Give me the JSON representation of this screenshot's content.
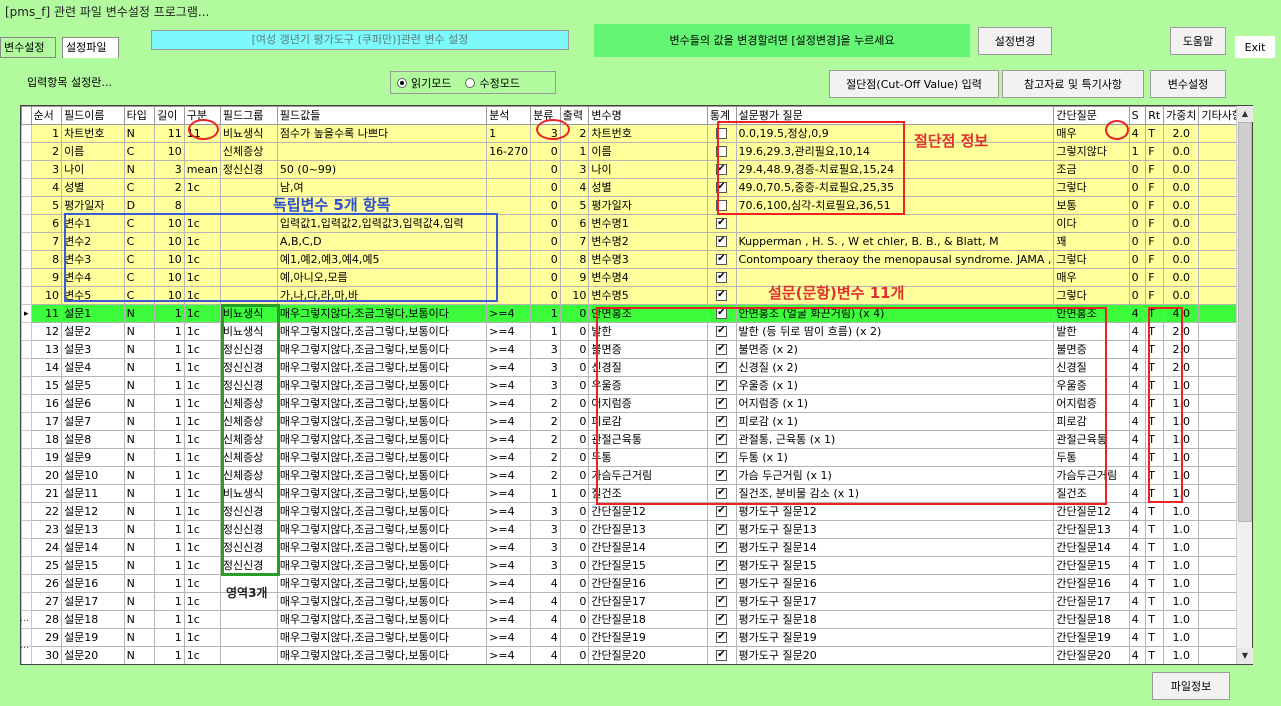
{
  "window": {
    "title": "[pms_f] 관련 파일 변수설정 프로그램..."
  },
  "tabs": [
    {
      "label": "변수설정"
    },
    {
      "label": "설정파일"
    }
  ],
  "header": {
    "form_title": "[여성 갱년기 평가도구 (쿠퍼만)]관련 변수 설정",
    "message": "변수들의 값을 변경할려면 [설정변경]을 누르세요",
    "change_button": "설정변경",
    "help_button": "도움말",
    "exit_button": "Exit"
  },
  "toolbar": {
    "input_label": "입력항목 설정란...",
    "read_mode": "읽기모드",
    "edit_mode": "수정모드",
    "mode_selected": "read",
    "cutoff_button": "절단점(Cut-Off Value) 입력",
    "reference_button": "참고자료 및 특기사항",
    "variable_button": "변수설정"
  },
  "table": {
    "columns": [
      "순서",
      "필드이름",
      "타입",
      "길이",
      "구분",
      "필드그룹",
      "필드값들",
      "분석",
      "분류",
      "출력",
      "변수명",
      "통계",
      "설문평가 질문",
      "간단질문",
      "S",
      "Rt",
      "가중치",
      "기타사항"
    ],
    "rows": [
      [
        "1",
        "차트번호",
        "N",
        "11",
        "11",
        "비뇨생식",
        "점수가 높을수록 나쁘다",
        "1",
        "3",
        "2",
        "차트번호",
        "off",
        "0.0,19.5,정상,0,9",
        "매우",
        "4",
        "T",
        "2.0",
        "",
        "yel"
      ],
      [
        "2",
        "이름",
        "C",
        "10",
        "",
        "신체증상",
        "",
        "16-270",
        "0",
        "1",
        "이름",
        "off",
        "19.6,29.3,관리필요,10,14",
        "그렇지않다",
        "1",
        "F",
        "0.0",
        "",
        "yel"
      ],
      [
        "3",
        "나이",
        "N",
        "3",
        "mean",
        "정신신경",
        "50 (0~99)",
        "",
        "0",
        "3",
        "나이",
        "on",
        "29.4,48.9,경증-치료필요,15,24",
        "조금",
        "0",
        "F",
        "0.0",
        "",
        "yel"
      ],
      [
        "4",
        "성별",
        "C",
        "2",
        "1c",
        "",
        "남,여",
        "",
        "0",
        "4",
        "성별",
        "on",
        "49.0,70.5,중증-치료필요,25,35",
        "그렇다",
        "0",
        "F",
        "0.0",
        "",
        "yel"
      ],
      [
        "5",
        "평가일자",
        "D",
        "8",
        "",
        "",
        "",
        "",
        "0",
        "5",
        "평가일자",
        "off",
        "70.6,100,심각-치료필요,36,51",
        "보통",
        "0",
        "F",
        "0.0",
        "",
        "yel"
      ],
      [
        "6",
        "변수1",
        "C",
        "10",
        "1c",
        "",
        "입력값1,입력값2,입력값3,입력값4,입력",
        "",
        "0",
        "6",
        "변수명1",
        "on",
        "",
        "이다",
        "0",
        "F",
        "0.0",
        "",
        "yel"
      ],
      [
        "7",
        "변수2",
        "C",
        "10",
        "1c",
        "",
        "A,B,C,D",
        "",
        "0",
        "7",
        "변수명2",
        "on",
        "Kupperman , H. S. , W et chler, B. B., & Blatt, M",
        "꽤",
        "0",
        "F",
        "0.0",
        "",
        "yel"
      ],
      [
        "8",
        "변수3",
        "C",
        "10",
        "1c",
        "",
        "예1,예2,예3,예4,예5",
        "",
        "0",
        "8",
        "변수명3",
        "on",
        "Contompoary theraoy the menopausal syndrome. JAMA ,",
        "그렇다",
        "0",
        "F",
        "0.0",
        "",
        "yel"
      ],
      [
        "9",
        "변수4",
        "C",
        "10",
        "1c",
        "",
        "예,아니오,모름",
        "",
        "0",
        "9",
        "변수명4",
        "on",
        "",
        "매우",
        "0",
        "F",
        "0.0",
        "",
        "yel"
      ],
      [
        "10",
        "변수5",
        "C",
        "10",
        "1c",
        "",
        "가,나,다,라,마,바",
        "",
        "0",
        "10",
        "변수명5",
        "on",
        "",
        "그렇다",
        "0",
        "F",
        "0.0",
        "",
        "yel"
      ],
      [
        "11",
        "설문1",
        "N",
        "1",
        "1c",
        "비뇨생식",
        "매우그렇지않다,조금그렇다,보통이다",
        "&gt;=4",
        "1",
        "0",
        "안면홍조",
        "on",
        "안면홍조 (얼굴 화끈거림) (x 4)",
        "안면홍조",
        "4",
        "T",
        "4.0",
        "",
        "grn"
      ],
      [
        "12",
        "설문2",
        "N",
        "1",
        "1c",
        "비뇨생식",
        "매우그렇지않다,조금그렇다,보통이다",
        "&gt;=4",
        "1",
        "0",
        "발한",
        "on",
        "발한 (등 뒤로 땀이 흐름) (x 2)",
        "발한",
        "4",
        "T",
        "2.0",
        "",
        "wht"
      ],
      [
        "13",
        "설문3",
        "N",
        "1",
        "1c",
        "정신신경",
        "매우그렇지않다,조금그렇다,보통이다",
        "&gt;=4",
        "3",
        "0",
        "불면증",
        "on",
        "불면증 (x 2)",
        "불면증",
        "4",
        "T",
        "2.0",
        "",
        "wht"
      ],
      [
        "14",
        "설문4",
        "N",
        "1",
        "1c",
        "정신신경",
        "매우그렇지않다,조금그렇다,보통이다",
        "&gt;=4",
        "3",
        "0",
        "신경질",
        "on",
        "신경질 (x 2)",
        "신경질",
        "4",
        "T",
        "2.0",
        "",
        "wht"
      ],
      [
        "15",
        "설문5",
        "N",
        "1",
        "1c",
        "정신신경",
        "매우그렇지않다,조금그렇다,보통이다",
        "&gt;=4",
        "3",
        "0",
        "우울증",
        "on",
        "우울증 (x 1)",
        "우울증",
        "4",
        "T",
        "1.0",
        "",
        "wht"
      ],
      [
        "16",
        "설문6",
        "N",
        "1",
        "1c",
        "신체증상",
        "매우그렇지않다,조금그렇다,보통이다",
        "&gt;=4",
        "2",
        "0",
        "어지럼증",
        "on",
        "어지럼증 (x 1)",
        "어지럼증",
        "4",
        "T",
        "1.0",
        "",
        "wht"
      ],
      [
        "17",
        "설문7",
        "N",
        "1",
        "1c",
        "신체증상",
        "매우그렇지않다,조금그렇다,보통이다",
        "&gt;=4",
        "2",
        "0",
        "피로감",
        "on",
        "피로감 (x 1)",
        "피로감",
        "4",
        "T",
        "1.0",
        "",
        "wht"
      ],
      [
        "18",
        "설문8",
        "N",
        "1",
        "1c",
        "신체증상",
        "매우그렇지않다,조금그렇다,보통이다",
        "&gt;=4",
        "2",
        "0",
        "관절근육통",
        "on",
        "관절통, 근육통 (x 1)",
        "관절근육통",
        "4",
        "T",
        "1.0",
        "",
        "wht"
      ],
      [
        "19",
        "설문9",
        "N",
        "1",
        "1c",
        "신체증상",
        "매우그렇지않다,조금그렇다,보통이다",
        "&gt;=4",
        "2",
        "0",
        "두통",
        "on",
        "두통 (x 1)",
        "두통",
        "4",
        "T",
        "1.0",
        "",
        "wht"
      ],
      [
        "20",
        "설문10",
        "N",
        "1",
        "1c",
        "신체증상",
        "매우그렇지않다,조금그렇다,보통이다",
        "&gt;=4",
        "2",
        "0",
        "가슴두근거림",
        "on",
        "가슴 두근거림 (x 1)",
        "가슴두근거림",
        "4",
        "T",
        "1.0",
        "",
        "wht"
      ],
      [
        "21",
        "설문11",
        "N",
        "1",
        "1c",
        "비뇨생식",
        "매우그렇지않다,조금그렇다,보통이다",
        "&gt;=4",
        "1",
        "0",
        "질건조",
        "on",
        "질건조, 분비물 감소 (x 1)",
        "질건조",
        "4",
        "T",
        "1.0",
        "",
        "wht"
      ],
      [
        "22",
        "설문12",
        "N",
        "1",
        "1c",
        "정신신경",
        "매우그렇지않다,조금그렇다,보통이다",
        "&gt;=4",
        "3",
        "0",
        "간단질문12",
        "on",
        "평가도구 질문12",
        "간단질문12",
        "4",
        "T",
        "1.0",
        "",
        "wht"
      ],
      [
        "23",
        "설문13",
        "N",
        "1",
        "1c",
        "정신신경",
        "매우그렇지않다,조금그렇다,보통이다",
        "&gt;=4",
        "3",
        "0",
        "간단질문13",
        "on",
        "평가도구 질문13",
        "간단질문13",
        "4",
        "T",
        "1.0",
        "",
        "wht"
      ],
      [
        "24",
        "설문14",
        "N",
        "1",
        "1c",
        "정신신경",
        "매우그렇지않다,조금그렇다,보통이다",
        "&gt;=4",
        "3",
        "0",
        "간단질문14",
        "on",
        "평가도구 질문14",
        "간단질문14",
        "4",
        "T",
        "1.0",
        "",
        "wht"
      ],
      [
        "25",
        "설문15",
        "N",
        "1",
        "1c",
        "정신신경",
        "매우그렇지않다,조금그렇다,보통이다",
        "&gt;=4",
        "3",
        "0",
        "간단질문15",
        "on",
        "평가도구 질문15",
        "간단질문15",
        "4",
        "T",
        "1.0",
        "",
        "wht"
      ],
      [
        "26",
        "설문16",
        "N",
        "1",
        "1c",
        "",
        "매우그렇지않다,조금그렇다,보통이다",
        "&gt;=4",
        "4",
        "0",
        "간단질문16",
        "on",
        "평가도구 질문16",
        "간단질문16",
        "4",
        "T",
        "1.0",
        "",
        "wht"
      ],
      [
        "27",
        "설문17",
        "N",
        "1",
        "1c",
        "",
        "매우그렇지않다,조금그렇다,보통이다",
        "&gt;=4",
        "4",
        "0",
        "간단질문17",
        "on",
        "평가도구 질문17",
        "간단질문17",
        "4",
        "T",
        "1.0",
        "",
        "wht"
      ],
      [
        "28",
        "설문18",
        "N",
        "1",
        "1c",
        "",
        "매우그렇지않다,조금그렇다,보통이다",
        "&gt;=4",
        "4",
        "0",
        "간단질문18",
        "on",
        "평가도구 질문18",
        "간단질문18",
        "4",
        "T",
        "1.0",
        "",
        "wht"
      ],
      [
        "29",
        "설문19",
        "N",
        "1",
        "1c",
        "",
        "매우그렇지않다,조금그렇다,보통이다",
        "&gt;=4",
        "4",
        "0",
        "간단질문19",
        "on",
        "평가도구 질문19",
        "간단질문19",
        "4",
        "T",
        "1.0",
        "",
        "wht"
      ],
      [
        "30",
        "설문20",
        "N",
        "1",
        "1c",
        "",
        "매우그렇지않다,조금그렇다,보통이다",
        "&gt;=4",
        "4",
        "0",
        "간단질문20",
        "on",
        "평가도구 질문20",
        "간단질문20",
        "4",
        "T",
        "1.0",
        "",
        "wht"
      ]
    ]
  },
  "annotations": {
    "cutoff": "절단점 정보",
    "independent": "독립변수 5개 항목",
    "survey": "설문(문항)변수 11개",
    "domain": "영역3개"
  },
  "footer": {
    "file_info_button": "파일정보"
  }
}
